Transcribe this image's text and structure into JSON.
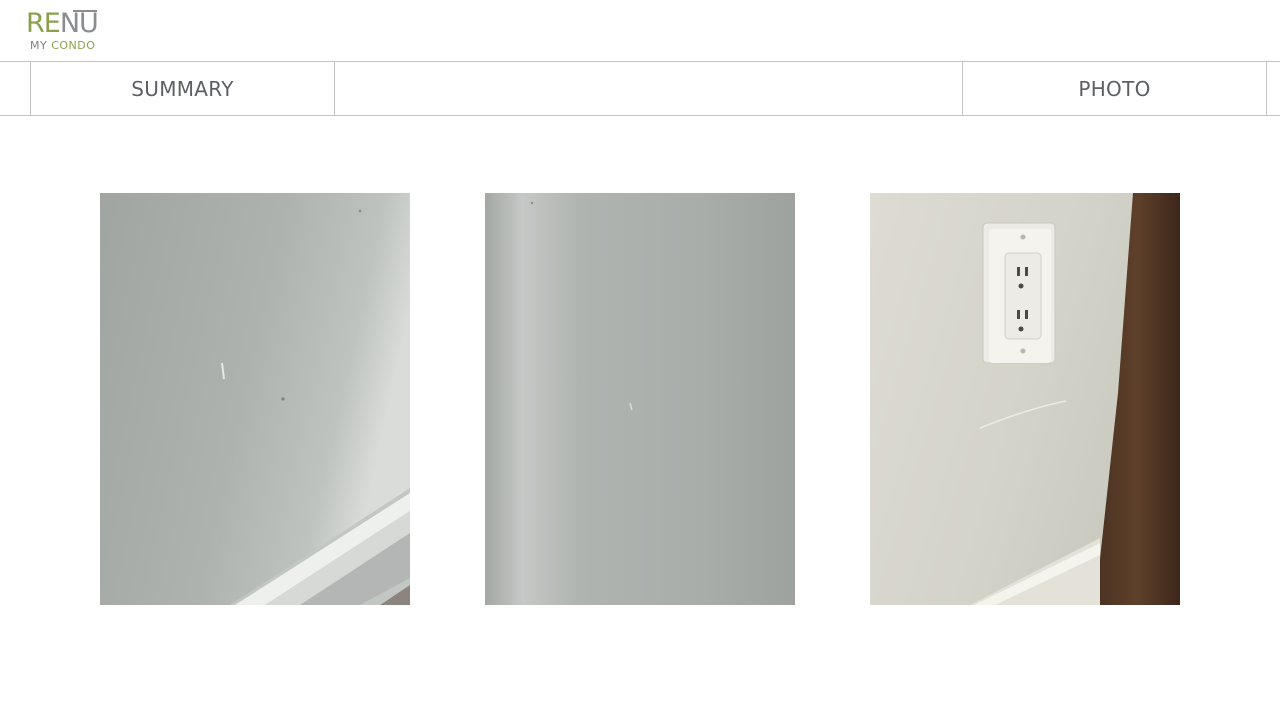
{
  "brand": {
    "logo_re": "RE",
    "logo_nu": "NU",
    "logo_my": "MY",
    "logo_condo": "CONDO",
    "accent_color": "#8aa04c",
    "gray_color": "#8b8c8e"
  },
  "tabs": [
    {
      "label": "SUMMARY"
    },
    {
      "label": "PHOTO"
    }
  ],
  "photos": [
    {
      "subject": "wall-scuff-near-baseboard"
    },
    {
      "subject": "plain-wall-section"
    },
    {
      "subject": "wall-outlet-near-door-frame"
    }
  ]
}
